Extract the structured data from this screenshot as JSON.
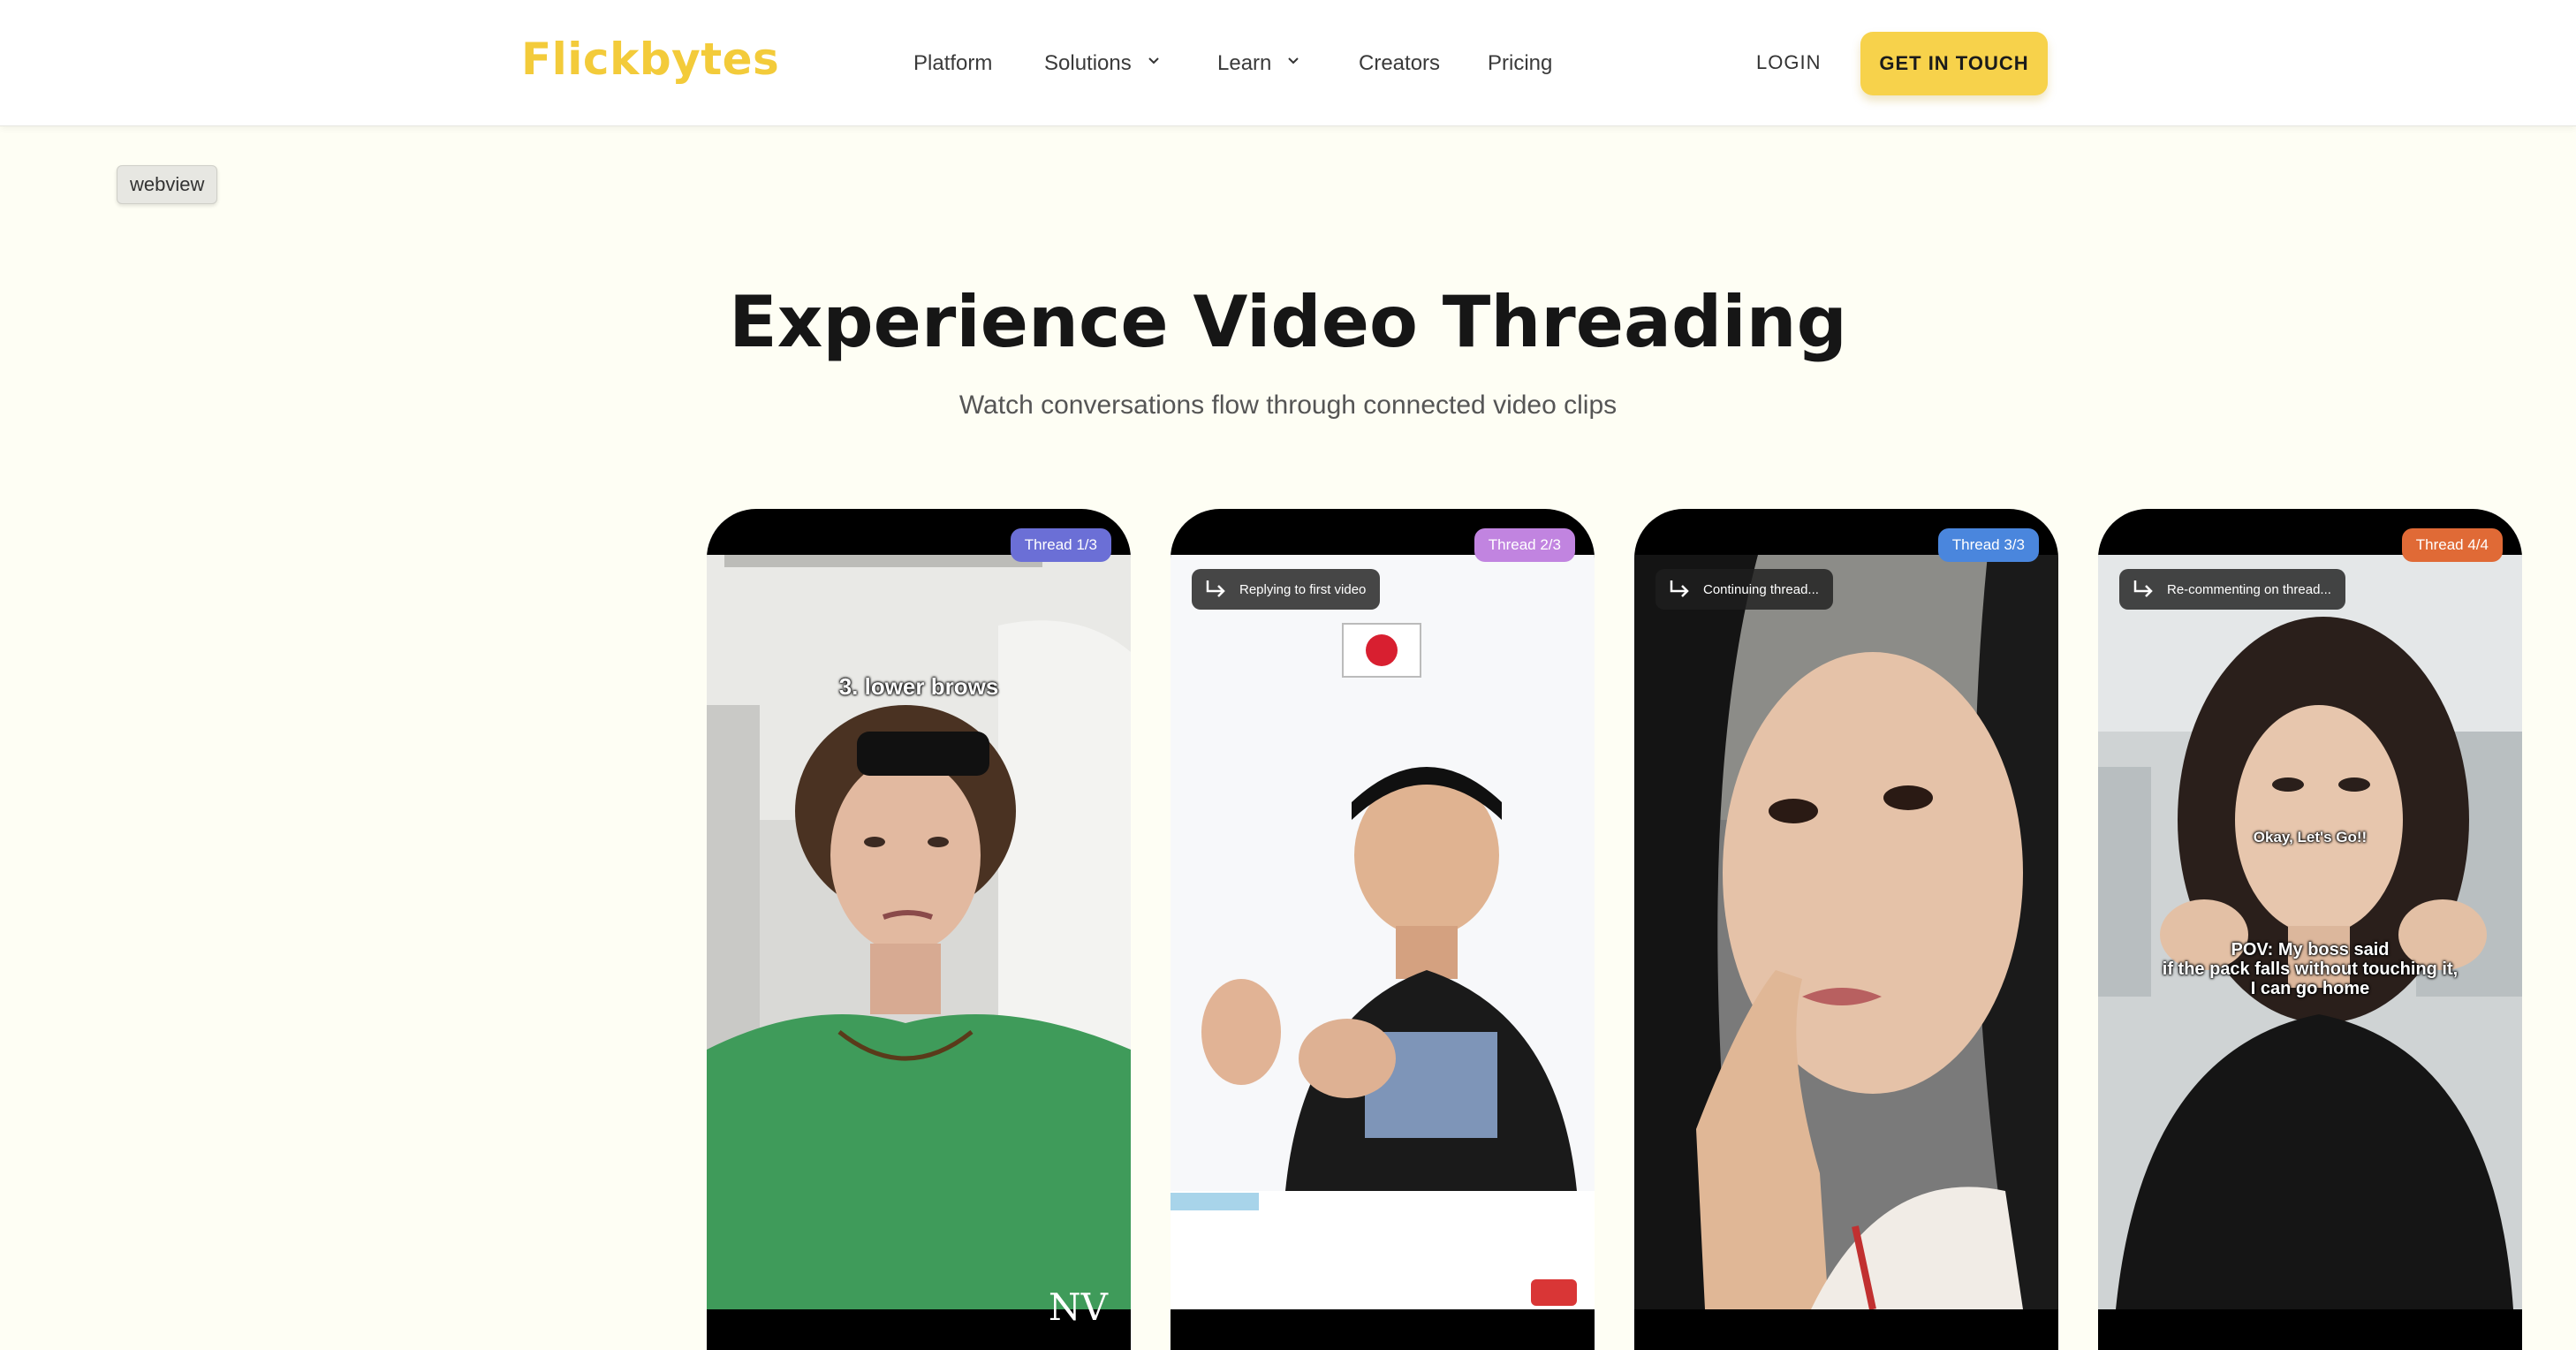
{
  "brand": {
    "name": "Flickbytes",
    "color": "#f3cb3a"
  },
  "nav": {
    "items": [
      {
        "label": "Platform",
        "dropdown": false
      },
      {
        "label": "Solutions",
        "dropdown": true
      },
      {
        "label": "Learn",
        "dropdown": true
      },
      {
        "label": "Creators",
        "dropdown": false
      },
      {
        "label": "Pricing",
        "dropdown": false
      }
    ],
    "login_label": "LOGIN",
    "cta_label": "GET IN TOUCH"
  },
  "tag": {
    "label": "webview"
  },
  "hero": {
    "title": "Experience Video Threading",
    "subtitle": "Watch conversations flow through connected video clips"
  },
  "threads": [
    {
      "badge": "Thread 1/3",
      "badge_color": "#6b6fd6",
      "reply": "",
      "captions": [
        "3. lower brows"
      ],
      "watermark": "NV"
    },
    {
      "badge": "Thread 2/3",
      "badge_color": "#c184e0",
      "reply": "Replying to first video",
      "captions": [],
      "watermark": ""
    },
    {
      "badge": "Thread 3/3",
      "badge_color": "#4a86dd",
      "reply": "Continuing thread...",
      "captions": [],
      "watermark": ""
    },
    {
      "badge": "Thread 4/4",
      "badge_color": "#e06a36",
      "reply": "Re-commenting on thread...",
      "captions": [
        "Okay, Let's Go!!",
        "POV: My boss said",
        "if the pack falls without touching it,",
        "I can go home"
      ],
      "watermark": ""
    }
  ]
}
